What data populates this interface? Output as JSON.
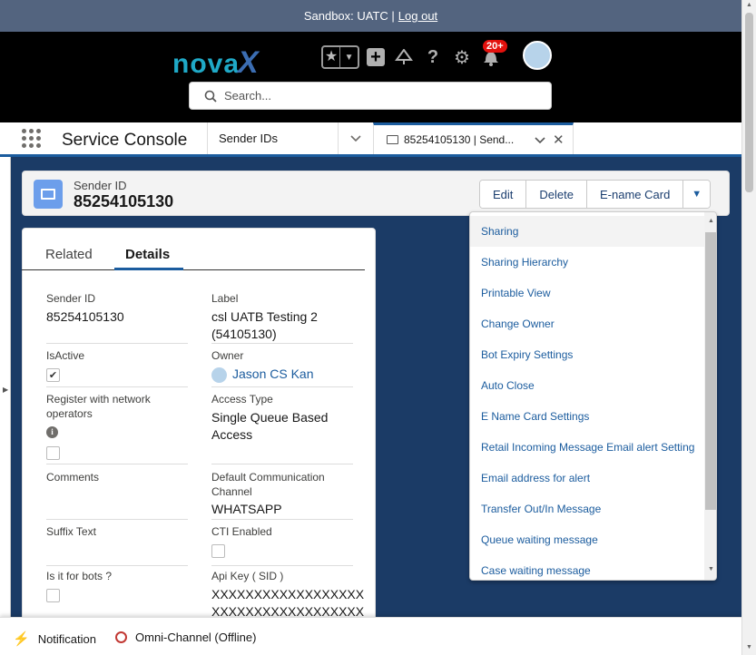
{
  "sandbox": {
    "text": "Sandbox: UATC |",
    "logout": "Log out"
  },
  "header": {
    "logo_main": "nova",
    "logo_x": "X",
    "search_placeholder": "Search...",
    "notification_count": "20+",
    "icons": [
      "star-icon",
      "chevron-down-icon",
      "plus-icon",
      "trailhead-icon",
      "help-icon",
      "gear-icon",
      "bell-icon",
      "avatar"
    ]
  },
  "nav": {
    "app_name": "Service Console",
    "selector_label": "Sender IDs",
    "tab_label": "85254105130 | Send..."
  },
  "record": {
    "type_label": "Sender ID",
    "title": "85254105130",
    "buttons": [
      "Edit",
      "Delete",
      "E-name Card"
    ]
  },
  "tabs": {
    "related": "Related",
    "details": "Details"
  },
  "fields": {
    "sender_id": {
      "label": "Sender ID",
      "value": "85254105130"
    },
    "label": {
      "label": "Label",
      "value1": "csl UATB Testing 2",
      "value2": "(54105130)"
    },
    "isactive": {
      "label": "IsActive",
      "checked": true
    },
    "owner": {
      "label": "Owner",
      "value": "Jason CS Kan"
    },
    "register": {
      "label1": "Register with network",
      "label2": "operators",
      "checked": false
    },
    "access_type": {
      "label": "Access Type",
      "value1": "Single Queue Based",
      "value2": "Access"
    },
    "comments": {
      "label": "Comments",
      "value": ""
    },
    "default_channel": {
      "label1": "Default Communication",
      "label2": "Channel",
      "value": "WHATSAPP"
    },
    "suffix": {
      "label": "Suffix Text",
      "value": ""
    },
    "cti": {
      "label": "CTI Enabled",
      "checked": false
    },
    "bots": {
      "label": "Is it for bots ?",
      "checked": false
    },
    "api_key": {
      "label": "Api Key ( SID )",
      "value1": "XXXXXXXXXXXXXXXXXX",
      "value2": "XXXXXXXXXXXXXXXXXX"
    }
  },
  "menu": {
    "items": [
      "Sharing",
      "Sharing Hierarchy",
      "Printable View",
      "Change Owner",
      "Bot Expiry Settings",
      "Auto Close",
      "E Name Card Settings",
      "Retail Incoming Message Email alert Setting",
      "Email address for alert",
      "Transfer Out/In Message",
      "Queue waiting message",
      "Case waiting message"
    ]
  },
  "utility": {
    "notification": "Notification",
    "omni": "Omni-Channel (Offline)"
  }
}
